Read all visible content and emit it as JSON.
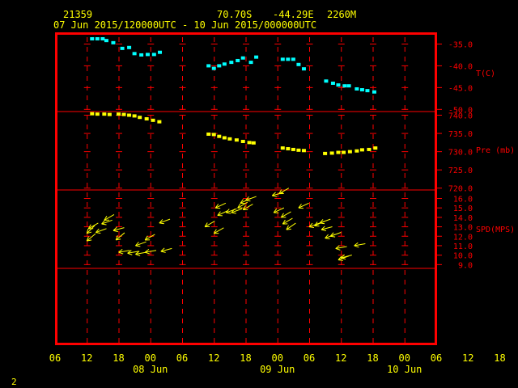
{
  "header": {
    "station": "21359",
    "lat": "70.70S",
    "lon": "-44.29E",
    "elev": "2260M",
    "period": "07 Jun 2015/120000UTC - 10 Jun 2015/000000UTC"
  },
  "footer": {
    "page": "2"
  },
  "colors": {
    "frame": "#ff0000",
    "temp": "#00ffff",
    "pressure": "#ffff00",
    "wind": "#ffff00",
    "text": "#ffff00",
    "axis_text": "#ff0000",
    "background": "#000000"
  },
  "chart_data": {
    "type": "scatter",
    "x_axis": {
      "unit": "hours since 07 Jun 2015 06UTC",
      "ticks": [
        0,
        6,
        12,
        18,
        24,
        30,
        36,
        42,
        48,
        54,
        60,
        66,
        72,
        78,
        84,
        90
      ],
      "tick_labels": [
        "06",
        "12",
        "18",
        "00",
        "06",
        "12",
        "18",
        "00",
        "06",
        "12",
        "18",
        "00",
        "06",
        "12",
        "18",
        "00",
        "06"
      ],
      "tick_labels_all": [
        "06",
        "12",
        "18",
        "00",
        "06",
        "12",
        "18",
        "00",
        "06",
        "12",
        "18",
        "00",
        "06",
        "12",
        "18",
        "00",
        "06"
      ],
      "day_labels": [
        {
          "label": "08 Jun",
          "at": 18
        },
        {
          "label": "09 Jun",
          "at": 42
        },
        {
          "label": "10 Jun",
          "at": 66
        }
      ],
      "range": [
        0,
        72
      ]
    },
    "panels": [
      {
        "name": "temperature",
        "label": "T(C)",
        "ticks": [
          -35.0,
          -40.0,
          -45.0,
          -50.0
        ],
        "tick_labels": [
          "-35.0",
          "-40.0",
          "-45.0",
          "-50.0"
        ],
        "ylim": [
          -50.5,
          -32.5
        ],
        "color": "#00ffff",
        "points": [
          [
            7.0,
            -33.8
          ],
          [
            8.0,
            -33.8
          ],
          [
            9.0,
            -33.8
          ],
          [
            9.7,
            -34.2
          ],
          [
            11.0,
            -34.7
          ],
          [
            12.7,
            -36.0
          ],
          [
            14.0,
            -35.8
          ],
          [
            15.0,
            -37.2
          ],
          [
            16.3,
            -37.5
          ],
          [
            17.5,
            -37.4
          ],
          [
            18.7,
            -37.4
          ],
          [
            19.8,
            -36.9
          ],
          [
            29.0,
            -40.0
          ],
          [
            30.0,
            -40.6
          ],
          [
            31.0,
            -40.0
          ],
          [
            32.0,
            -39.6
          ],
          [
            33.3,
            -39.2
          ],
          [
            34.5,
            -38.8
          ],
          [
            35.5,
            -38.2
          ],
          [
            37.0,
            -39.2
          ],
          [
            38.0,
            -38.0
          ],
          [
            43.0,
            -38.5
          ],
          [
            44.0,
            -38.5
          ],
          [
            45.0,
            -38.5
          ],
          [
            46.0,
            -39.7
          ],
          [
            47.0,
            -40.7
          ],
          [
            51.2,
            -43.5
          ],
          [
            52.5,
            -44.0
          ],
          [
            53.5,
            -44.4
          ],
          [
            54.7,
            -44.6
          ],
          [
            55.5,
            -44.6
          ],
          [
            57.0,
            -45.3
          ],
          [
            58.0,
            -45.5
          ],
          [
            59.0,
            -45.7
          ],
          [
            60.3,
            -46.0
          ]
        ]
      },
      {
        "name": "pressure",
        "label": "Pre (mb)",
        "ticks": [
          740.0,
          735.0,
          730.0,
          725.0,
          720.0
        ],
        "tick_labels": [
          "740.0",
          "735.0",
          "730.0",
          "725.0",
          "720.0"
        ],
        "ylim": [
          719.5,
          741.0
        ],
        "color": "#ffff00",
        "points": [
          [
            7.0,
            740.4
          ],
          [
            8.0,
            740.3
          ],
          [
            9.3,
            740.3
          ],
          [
            10.3,
            740.2
          ],
          [
            12.0,
            740.3
          ],
          [
            13.0,
            740.2
          ],
          [
            14.0,
            740.0
          ],
          [
            15.0,
            739.8
          ],
          [
            16.0,
            739.4
          ],
          [
            17.3,
            739.0
          ],
          [
            18.5,
            738.6
          ],
          [
            19.7,
            738.2
          ],
          [
            29.0,
            734.8
          ],
          [
            30.0,
            734.7
          ],
          [
            31.0,
            734.2
          ],
          [
            32.0,
            733.8
          ],
          [
            33.0,
            733.5
          ],
          [
            34.3,
            733.2
          ],
          [
            35.5,
            732.8
          ],
          [
            36.7,
            732.5
          ],
          [
            37.5,
            732.4
          ],
          [
            43.0,
            731.0
          ],
          [
            44.0,
            730.8
          ],
          [
            45.0,
            730.6
          ],
          [
            46.0,
            730.4
          ],
          [
            47.0,
            730.3
          ],
          [
            51.0,
            729.5
          ],
          [
            52.3,
            729.6
          ],
          [
            53.5,
            729.8
          ],
          [
            54.5,
            729.8
          ],
          [
            55.7,
            730.0
          ],
          [
            57.0,
            730.2
          ],
          [
            58.0,
            730.5
          ],
          [
            59.3,
            730.6
          ],
          [
            60.5,
            731.0
          ]
        ]
      },
      {
        "name": "wind",
        "label": "SPD(MPS)",
        "ticks": [
          16.0,
          15.0,
          14.0,
          13.0,
          12.0,
          11.0,
          10.0,
          9.0
        ],
        "tick_labels": [
          "16.0",
          "15.0",
          "14.0",
          "13.0",
          "12.0",
          "11.0",
          "10.0",
          "9.0"
        ],
        "ylim": [
          8.6,
          16.9
        ],
        "color": "#ffff00",
        "barbs": [
          [
            6.0,
            12.3,
            45
          ],
          [
            6.3,
            12.8,
            30
          ],
          [
            6.0,
            11.5,
            40
          ],
          [
            7.7,
            12.4,
            20
          ],
          [
            9.3,
            13.7,
            30
          ],
          [
            8.8,
            13.3,
            20
          ],
          [
            11.5,
            11.6,
            40
          ],
          [
            11.0,
            12.6,
            15
          ],
          [
            12.0,
            10.3,
            10
          ],
          [
            13.7,
            10.2,
            10
          ],
          [
            15.2,
            11.0,
            20
          ],
          [
            15.2,
            10.1,
            10
          ],
          [
            17.0,
            10.3,
            10
          ],
          [
            17.0,
            11.6,
            30
          ],
          [
            19.7,
            13.4,
            20
          ],
          [
            20.0,
            10.4,
            15
          ],
          [
            28.3,
            13.0,
            30
          ],
          [
            30.0,
            12.3,
            30
          ],
          [
            30.3,
            15.0,
            25
          ],
          [
            30.7,
            14.2,
            25
          ],
          [
            32.3,
            14.5,
            20
          ],
          [
            33.3,
            14.5,
            20
          ],
          [
            34.5,
            15.0,
            30
          ],
          [
            35.0,
            15.5,
            25
          ],
          [
            35.5,
            14.8,
            30
          ],
          [
            36.0,
            15.8,
            20
          ],
          [
            41.0,
            16.3,
            15
          ],
          [
            42.3,
            16.5,
            30
          ],
          [
            41.3,
            14.5,
            25
          ],
          [
            42.7,
            14.0,
            30
          ],
          [
            43.0,
            13.3,
            30
          ],
          [
            43.7,
            12.7,
            35
          ],
          [
            46.0,
            15.0,
            25
          ],
          [
            48.0,
            13.0,
            20
          ],
          [
            49.0,
            13.1,
            25
          ],
          [
            50.0,
            13.4,
            20
          ],
          [
            50.3,
            12.7,
            15
          ],
          [
            51.0,
            11.8,
            20
          ],
          [
            52.0,
            12.0,
            20
          ],
          [
            53.0,
            10.7,
            10
          ],
          [
            53.5,
            9.5,
            20
          ],
          [
            54.0,
            9.7,
            15
          ],
          [
            56.5,
            11.0,
            10
          ]
        ]
      }
    ]
  }
}
